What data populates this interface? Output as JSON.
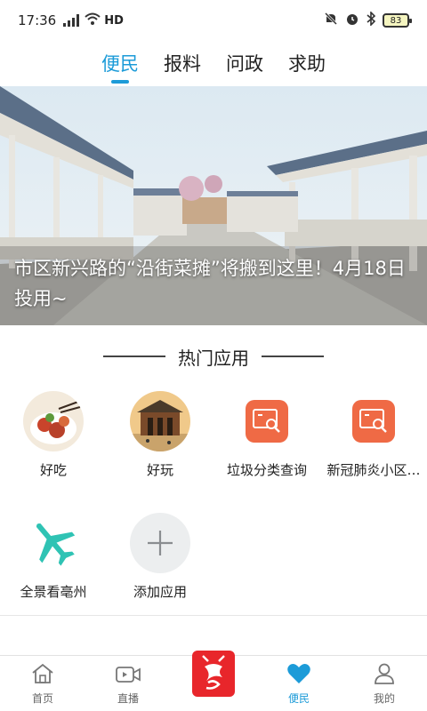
{
  "status_bar": {
    "time": "17:36",
    "network_type": "4G",
    "hd_label": "HD",
    "battery": "83",
    "icons": [
      "signal-icon",
      "wifi-icon",
      "mute-icon",
      "alarm-icon",
      "bluetooth-icon",
      "battery-icon"
    ]
  },
  "tabs": [
    {
      "label": "便民",
      "active": true
    },
    {
      "label": "报料",
      "active": false
    },
    {
      "label": "问政",
      "active": false
    },
    {
      "label": "求助",
      "active": false
    }
  ],
  "banner": {
    "caption": "市区新兴路的“沿街菜摊”将搬到这里！4月18日投用~"
  },
  "section": {
    "title": "热门应用"
  },
  "apps": [
    {
      "label": "好吃",
      "icon": "food-photo-icon"
    },
    {
      "label": "好玩",
      "icon": "building-photo-icon"
    },
    {
      "label": "垃圾分类查询",
      "icon": "search-document-icon"
    },
    {
      "label": "新冠肺炎小区…",
      "icon": "search-document-icon"
    },
    {
      "label": "全景看亳州",
      "icon": "airplane-icon"
    },
    {
      "label": "添加应用",
      "icon": "plus-icon"
    }
  ],
  "bottom_nav": [
    {
      "label": "首页",
      "icon": "home-icon",
      "active": false
    },
    {
      "label": "直播",
      "icon": "video-icon",
      "active": false
    },
    {
      "label": "",
      "icon": "app-logo-icon",
      "active": false
    },
    {
      "label": "便民",
      "icon": "heart-icon",
      "active": true
    },
    {
      "label": "我的",
      "icon": "user-icon",
      "active": false
    }
  ],
  "colors": {
    "accent": "#1c9bd8",
    "orange": "#ef6a45",
    "airplane": "#2fc3b4",
    "logo_red": "#e8262b"
  }
}
